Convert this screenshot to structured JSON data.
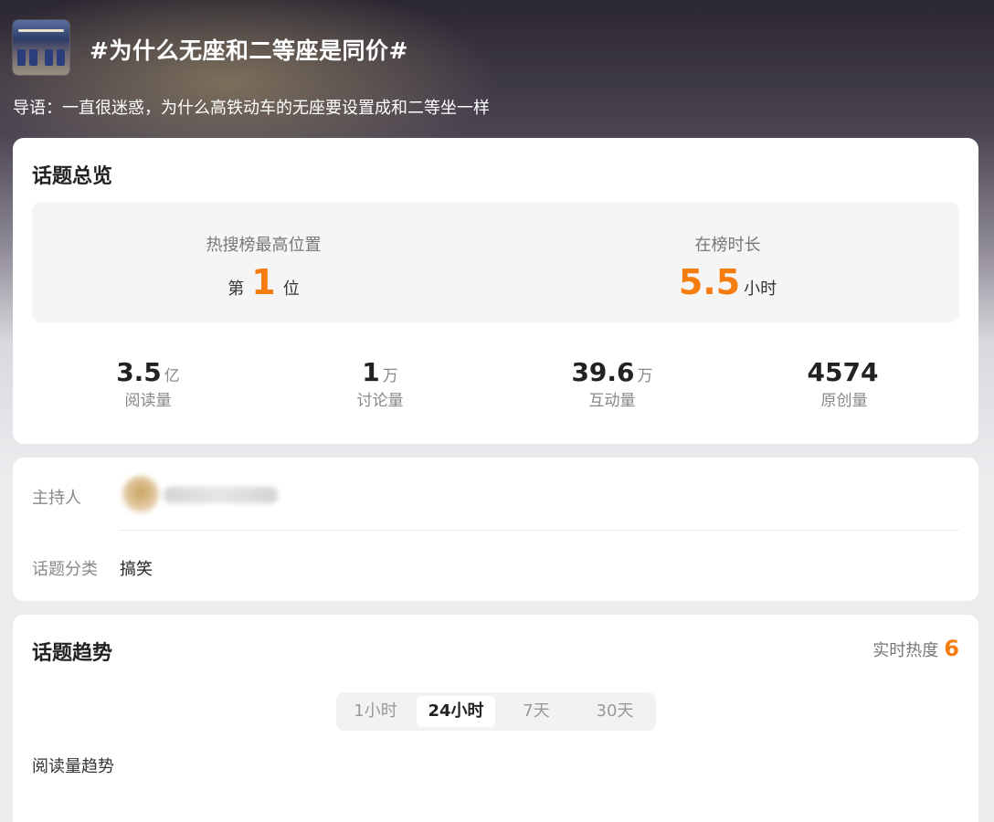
{
  "header": {
    "title": "#为什么无座和二等座是同价#",
    "intro": "导语：一直很迷惑，为什么高铁动车的无座要设置成和二等坐一样"
  },
  "overview": {
    "title": "话题总览",
    "rank": {
      "label": "热搜榜最高位置",
      "prefix": "第",
      "value": "1",
      "suffix": "位"
    },
    "duration": {
      "label": "在榜时长",
      "value": "5.5",
      "unit": "小时"
    },
    "stats": [
      {
        "value": "3.5",
        "unit": "亿",
        "label": "阅读量"
      },
      {
        "value": "1",
        "unit": "万",
        "label": "讨论量"
      },
      {
        "value": "39.6",
        "unit": "万",
        "label": "互动量"
      },
      {
        "value": "4574",
        "unit": "",
        "label": "原创量"
      }
    ]
  },
  "info": {
    "host_label": "主持人",
    "category_label": "话题分类",
    "category_value": "搞笑"
  },
  "trend": {
    "title": "话题趋势",
    "heat_label": "实时热度",
    "heat_value": "6",
    "tabs": [
      "1小时",
      "24小时",
      "7天",
      "30天"
    ],
    "active_tab": "24小时",
    "chart_label": "阅读量趋势"
  },
  "colors": {
    "accent": "#f57c0f",
    "card": "#ffffff",
    "page": "#ececef"
  }
}
